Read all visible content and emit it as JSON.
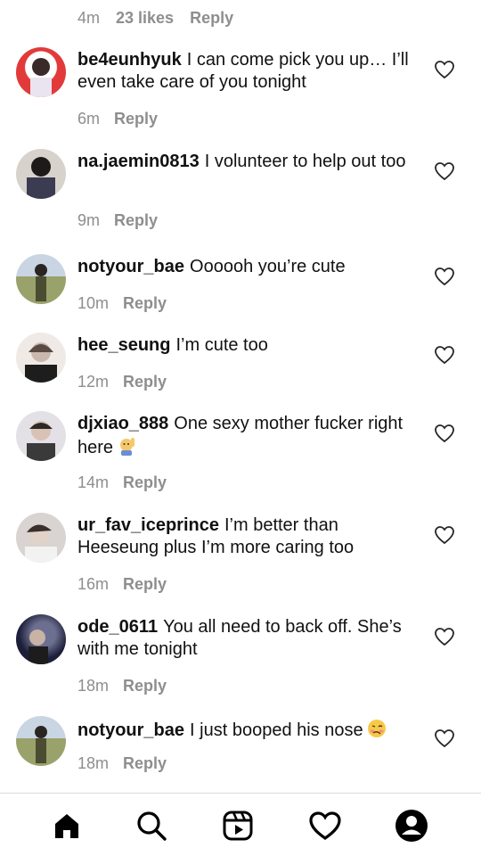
{
  "top_meta": {
    "time": "4m",
    "likes": "23 likes",
    "reply": "Reply"
  },
  "comments": [
    {
      "username": "be4eunhyuk",
      "text": "I can come pick you up… I’ll even take care of you tonight",
      "time": "6m",
      "reply": "Reply"
    },
    {
      "username": "na.jaemin0813",
      "text": "I volunteer to help out too",
      "time": "9m",
      "reply": "Reply"
    },
    {
      "username": "notyour_bae",
      "text": "Oooooh you’re cute",
      "time": "10m",
      "reply": "Reply"
    },
    {
      "username": "hee_seung",
      "text": "I’m cute too",
      "time": "12m",
      "reply": "Reply"
    },
    {
      "username": "djxiao_888",
      "text": "One sexy mother fucker right here",
      "time": "14m",
      "reply": "Reply"
    },
    {
      "username": "ur_fav_iceprince",
      "text": "I’m better than Heeseung plus I’m more caring too",
      "time": "16m",
      "reply": "Reply"
    },
    {
      "username": "ode_0611",
      "text": "You all need to back off. She’s with me tonight",
      "time": "18m",
      "reply": "Reply"
    },
    {
      "username": "notyour_bae",
      "text": "I just booped his nose",
      "time": "18m",
      "reply": "Reply"
    }
  ],
  "emojis": {
    "comment_5": "person-raising-hand-emoji",
    "comment_8": "woozy-face-emoji"
  },
  "nav": [
    "home-icon",
    "search-icon",
    "reels-icon",
    "heart-icon",
    "profile-icon"
  ],
  "colors": {
    "muted": "#8e8e8e",
    "text": "#111111",
    "divider": "#dbdbdb"
  }
}
